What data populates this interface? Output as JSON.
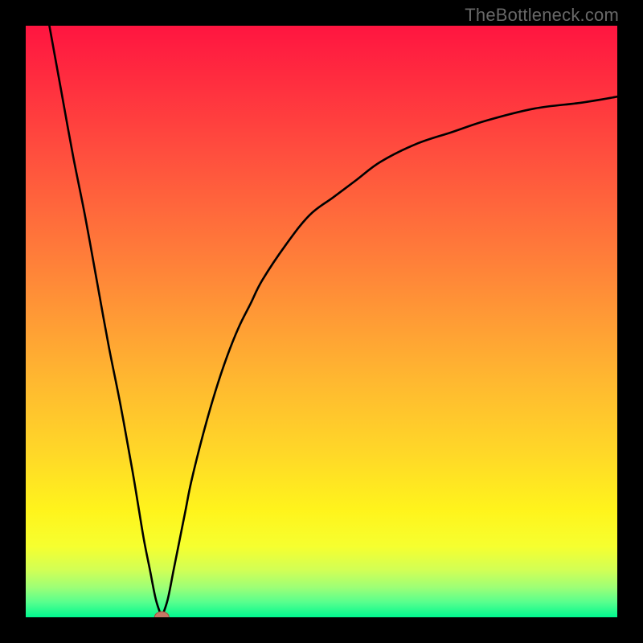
{
  "watermark": "TheBottleneck.com",
  "colors": {
    "black": "#000000",
    "curve": "#000000",
    "dot_fill": "#c57866",
    "dot_stroke": "#a85040",
    "watermark": "#686868",
    "gradient_stops": [
      {
        "offset": 0.0,
        "color": "#ff1540"
      },
      {
        "offset": 0.1,
        "color": "#ff2f3f"
      },
      {
        "offset": 0.2,
        "color": "#ff4a3e"
      },
      {
        "offset": 0.3,
        "color": "#ff653c"
      },
      {
        "offset": 0.4,
        "color": "#ff8039"
      },
      {
        "offset": 0.5,
        "color": "#ff9c35"
      },
      {
        "offset": 0.6,
        "color": "#ffb830"
      },
      {
        "offset": 0.72,
        "color": "#ffd728"
      },
      {
        "offset": 0.82,
        "color": "#fff41c"
      },
      {
        "offset": 0.88,
        "color": "#f6ff2f"
      },
      {
        "offset": 0.92,
        "color": "#d2ff55"
      },
      {
        "offset": 0.95,
        "color": "#9cff77"
      },
      {
        "offset": 0.975,
        "color": "#56ff8e"
      },
      {
        "offset": 1.0,
        "color": "#00f88f"
      }
    ]
  },
  "chart_data": {
    "type": "line",
    "title": "",
    "xlabel": "",
    "ylabel": "",
    "xlim": [
      0,
      100
    ],
    "ylim": [
      0,
      100
    ],
    "grid": false,
    "series": [
      {
        "name": "left-branch",
        "x": [
          4,
          6,
          8,
          10,
          12,
          14,
          16,
          18,
          19,
          20,
          21,
          22,
          23
        ],
        "y": [
          100,
          89,
          78,
          68,
          57,
          46,
          36,
          25,
          19,
          13,
          8,
          3,
          0
        ]
      },
      {
        "name": "right-branch",
        "x": [
          23,
          24,
          25,
          26,
          27,
          28,
          30,
          32,
          34,
          36,
          38,
          40,
          44,
          48,
          52,
          56,
          60,
          66,
          72,
          78,
          86,
          94,
          100
        ],
        "y": [
          0,
          3,
          8,
          13,
          18,
          23,
          31,
          38,
          44,
          49,
          53,
          57,
          63,
          68,
          71,
          74,
          77,
          80,
          82,
          84,
          86,
          87,
          88
        ]
      }
    ],
    "marker": {
      "name": "minimum-point",
      "x": 23,
      "y": 0
    }
  }
}
